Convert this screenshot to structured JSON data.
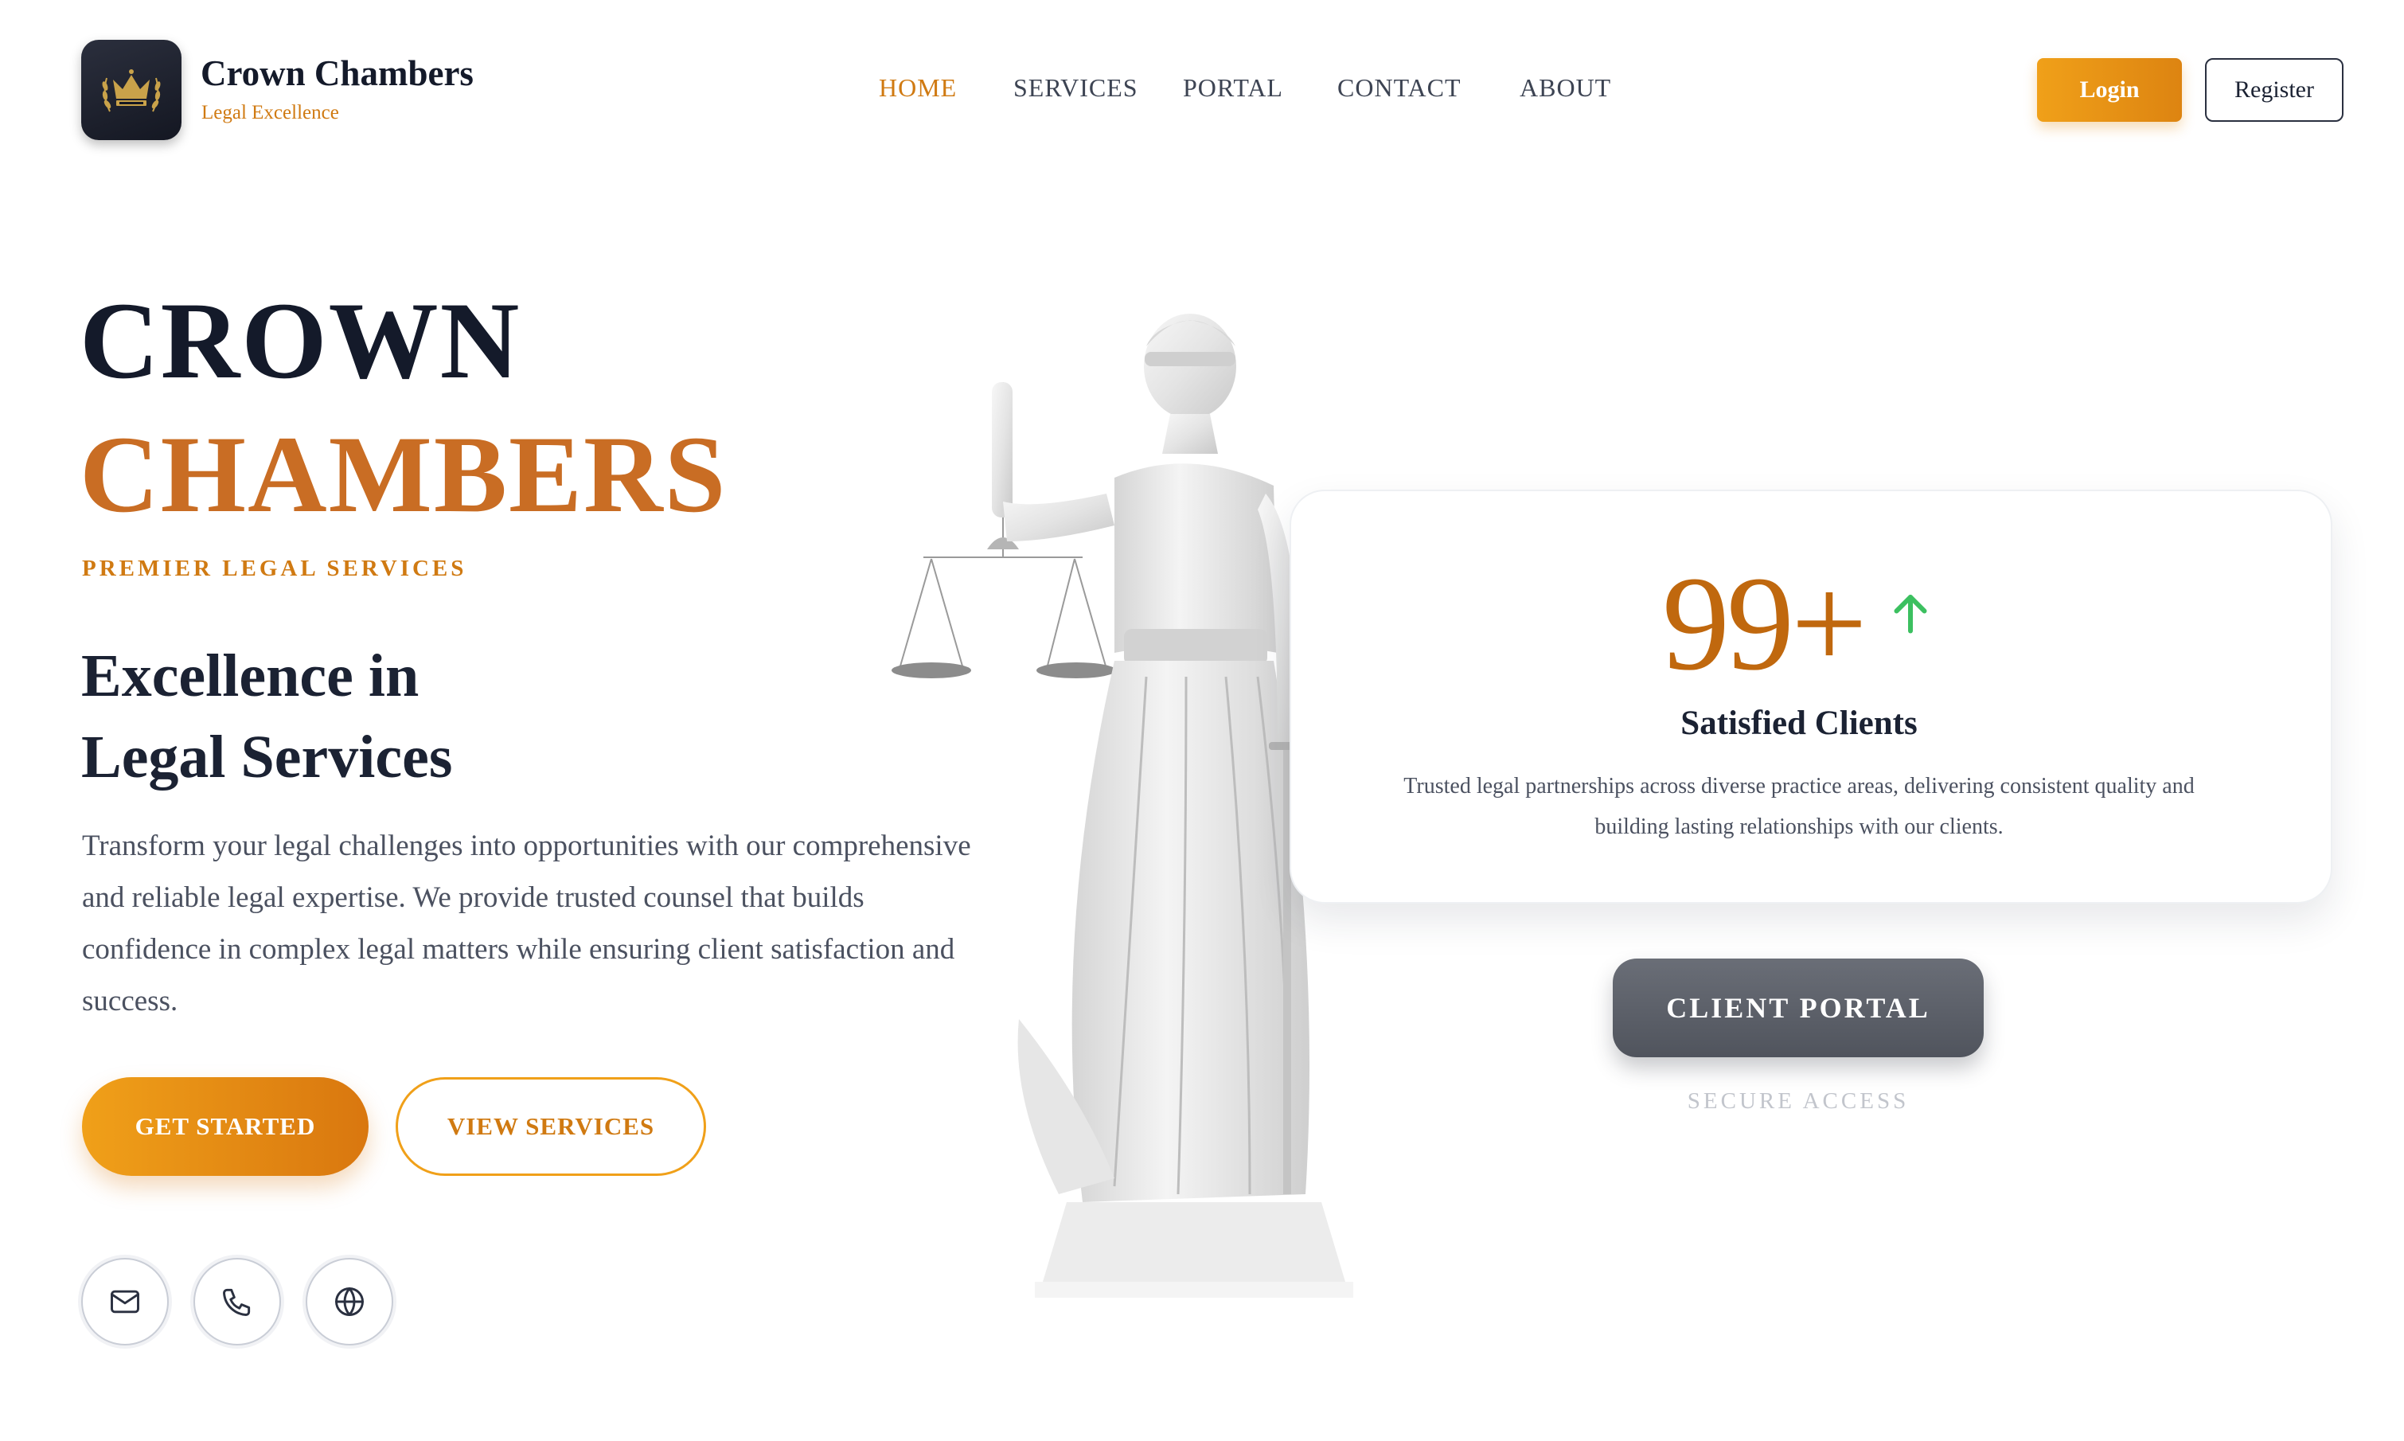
{
  "brand": {
    "name": "Crown Chambers",
    "tagline": "Legal Excellence",
    "logo_icon": "crown-laurel-icon"
  },
  "nav": {
    "items": [
      {
        "label": "HOME",
        "active": true
      },
      {
        "label": "SERVICES",
        "active": false
      },
      {
        "label": "PORTAL",
        "active": false
      },
      {
        "label": "CONTACT",
        "active": false
      },
      {
        "label": "ABOUT",
        "active": false
      }
    ],
    "login_label": "Login",
    "register_label": "Register"
  },
  "hero": {
    "title_line1": "CROWN",
    "title_line2": "CHAMBERS",
    "eyebrow": "PREMIER LEGAL SERVICES",
    "subtitle": "Excellence in Legal Services",
    "description": "Transform your legal challenges into opportunities with our comprehensive and reliable legal expertise. We provide trusted counsel that builds confidence in complex legal matters while ensuring client satisfaction and success.",
    "primary_button": "GET STARTED",
    "secondary_button": "VIEW SERVICES",
    "contact_icons": [
      "mail-icon",
      "phone-icon",
      "globe-icon"
    ]
  },
  "stat_card": {
    "value": "99+",
    "trend_icon": "arrow-up-icon",
    "label": "Satisfied Clients",
    "description": "Trusted legal partnerships across diverse practice areas, delivering consistent quality and building lasting relationships with our clients."
  },
  "portal": {
    "button_label": "CLIENT PORTAL",
    "subtext": "SECURE ACCESS"
  },
  "colors": {
    "accent": "#d07a12",
    "accent_light": "#f0a019",
    "title_copper": "#c96d24",
    "navy": "#141a2a",
    "trend_green": "#3cc060"
  }
}
